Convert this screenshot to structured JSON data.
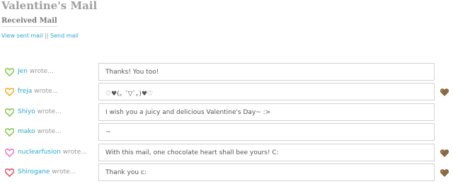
{
  "page": {
    "title": "Valentine's Mail",
    "subtitle": "Received Mail",
    "links": {
      "view_sent": "View sent mail",
      "separator": "||",
      "send": "Send mail"
    }
  },
  "colors": {
    "link": "#2aa9c9",
    "heart_green": "#8fcf5d",
    "heart_orange": "#f2b83a",
    "heart_pink": "#ef83c8",
    "heart_red": "#ea6070",
    "chocolate": "#8b6a3f"
  },
  "mails": [
    {
      "sender": "Jen",
      "suffix": "wrote...",
      "message": "Thanks! You too!",
      "heart_color": "green",
      "has_chocolate": false
    },
    {
      "sender": "freja",
      "suffix": "wrote...",
      "message": "♡♥(｡ ´▽`｡)♥♡",
      "heart_color": "orange",
      "has_chocolate": true
    },
    {
      "sender": "Shiyo",
      "suffix": "wrote...",
      "message": "I wish you a juicy and delicious Valentine's Day~ :>",
      "heart_color": "green",
      "has_chocolate": false
    },
    {
      "sender": "mako",
      "suffix": "wrote...",
      "message": "~",
      "heart_color": "green",
      "has_chocolate": false
    },
    {
      "sender": "nuclearfusion",
      "suffix": "wrote...",
      "message": "With this mail, one chocolate heart shall bee yours! C:",
      "heart_color": "pink",
      "has_chocolate": true
    },
    {
      "sender": "Shirogane",
      "suffix": "wrote...",
      "message": "Thank you c:",
      "heart_color": "red",
      "has_chocolate": true
    }
  ]
}
